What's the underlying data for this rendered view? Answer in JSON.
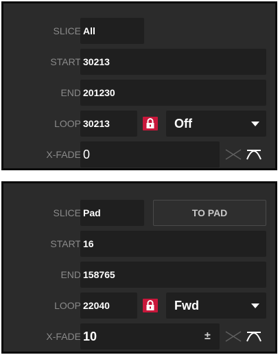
{
  "panel_a": {
    "slice_label": "SLICE",
    "slice_value": "All",
    "start_label": "START",
    "start_value": "30213",
    "end_label": "END",
    "end_value": "201230",
    "loop_label": "LOOP",
    "loop_value": "30213",
    "loop_mode": "Off",
    "xfade_label": "X-FADE",
    "xfade_value": "0"
  },
  "panel_b": {
    "slice_label": "SLICE",
    "slice_value": "Pad",
    "to_pad_label": "TO PAD",
    "start_label": "START",
    "start_value": "16",
    "end_label": "END",
    "end_value": "158765",
    "loop_label": "LOOP",
    "loop_value": "22040",
    "loop_mode": "Fwd",
    "xfade_label": "X-FADE",
    "xfade_value": "10",
    "xfade_adjust": "±"
  },
  "colors": {
    "panel_bg": "#2b2b2b",
    "field_bg": "#1f1f1f",
    "label": "#8a8a8a",
    "lock_accent": "#c8173b"
  },
  "icons": [
    "lock-icon",
    "linear-crossfade-icon",
    "curved-crossfade-icon",
    "chevron-down-icon"
  ]
}
